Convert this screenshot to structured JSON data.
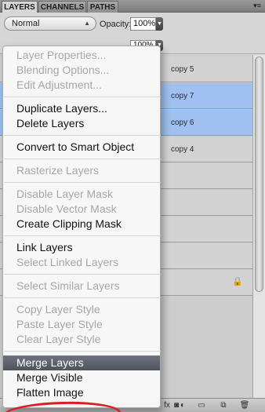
{
  "tabs": [
    {
      "label": "LAYERS",
      "active": true
    },
    {
      "label": "CHANNELS",
      "active": false
    },
    {
      "label": "PATHS",
      "active": false
    }
  ],
  "options": {
    "blend_mode": "Normal",
    "opacity_label": "Opacity:",
    "opacity_value": "100%",
    "fill_value": "100%"
  },
  "layers": [
    {
      "name": "copy 5",
      "selected": false,
      "locked": false
    },
    {
      "name": "copy 7",
      "selected": true,
      "locked": false
    },
    {
      "name": "copy 6",
      "selected": true,
      "locked": false
    },
    {
      "name": "copy 4",
      "selected": false,
      "locked": false
    },
    {
      "name": "",
      "selected": false,
      "locked": false
    },
    {
      "name": "",
      "selected": false,
      "locked": false
    },
    {
      "name": "",
      "selected": false,
      "locked": false
    },
    {
      "name": "",
      "selected": false,
      "locked": false
    },
    {
      "name": "",
      "selected": false,
      "locked": true
    }
  ],
  "bottom_icons": [
    "link-icon",
    "fx-icon",
    "mask-icon",
    "adjustment-icon",
    "folder-icon",
    "new-layer-icon",
    "trash-icon"
  ],
  "menu": [
    {
      "label": "Layer Properties...",
      "enabled": false
    },
    {
      "label": "Blending Options...",
      "enabled": false
    },
    {
      "label": "Edit Adjustment...",
      "enabled": false
    },
    {
      "separator": true
    },
    {
      "label": "Duplicate Layers...",
      "enabled": true
    },
    {
      "label": "Delete Layers",
      "enabled": true
    },
    {
      "separator": true
    },
    {
      "label": "Convert to Smart Object",
      "enabled": true
    },
    {
      "separator": true
    },
    {
      "label": "Rasterize Layers",
      "enabled": false
    },
    {
      "separator": true
    },
    {
      "label": "Disable Layer Mask",
      "enabled": false
    },
    {
      "label": "Disable Vector Mask",
      "enabled": false
    },
    {
      "label": "Create Clipping Mask",
      "enabled": true
    },
    {
      "separator": true
    },
    {
      "label": "Link Layers",
      "enabled": true
    },
    {
      "label": "Select Linked Layers",
      "enabled": false
    },
    {
      "separator": true
    },
    {
      "label": "Select Similar Layers",
      "enabled": false
    },
    {
      "separator": true
    },
    {
      "label": "Copy Layer Style",
      "enabled": false
    },
    {
      "label": "Paste Layer Style",
      "enabled": false
    },
    {
      "label": "Clear Layer Style",
      "enabled": false
    },
    {
      "separator": true
    },
    {
      "label": "Merge Layers",
      "enabled": true,
      "highlighted": true
    },
    {
      "label": "Merge Visible",
      "enabled": true
    },
    {
      "label": "Flatten Image",
      "enabled": true
    }
  ],
  "colors": {
    "selection": "#9fc0f0",
    "highlight": "#5d616b",
    "annotation": "#d81f26"
  }
}
